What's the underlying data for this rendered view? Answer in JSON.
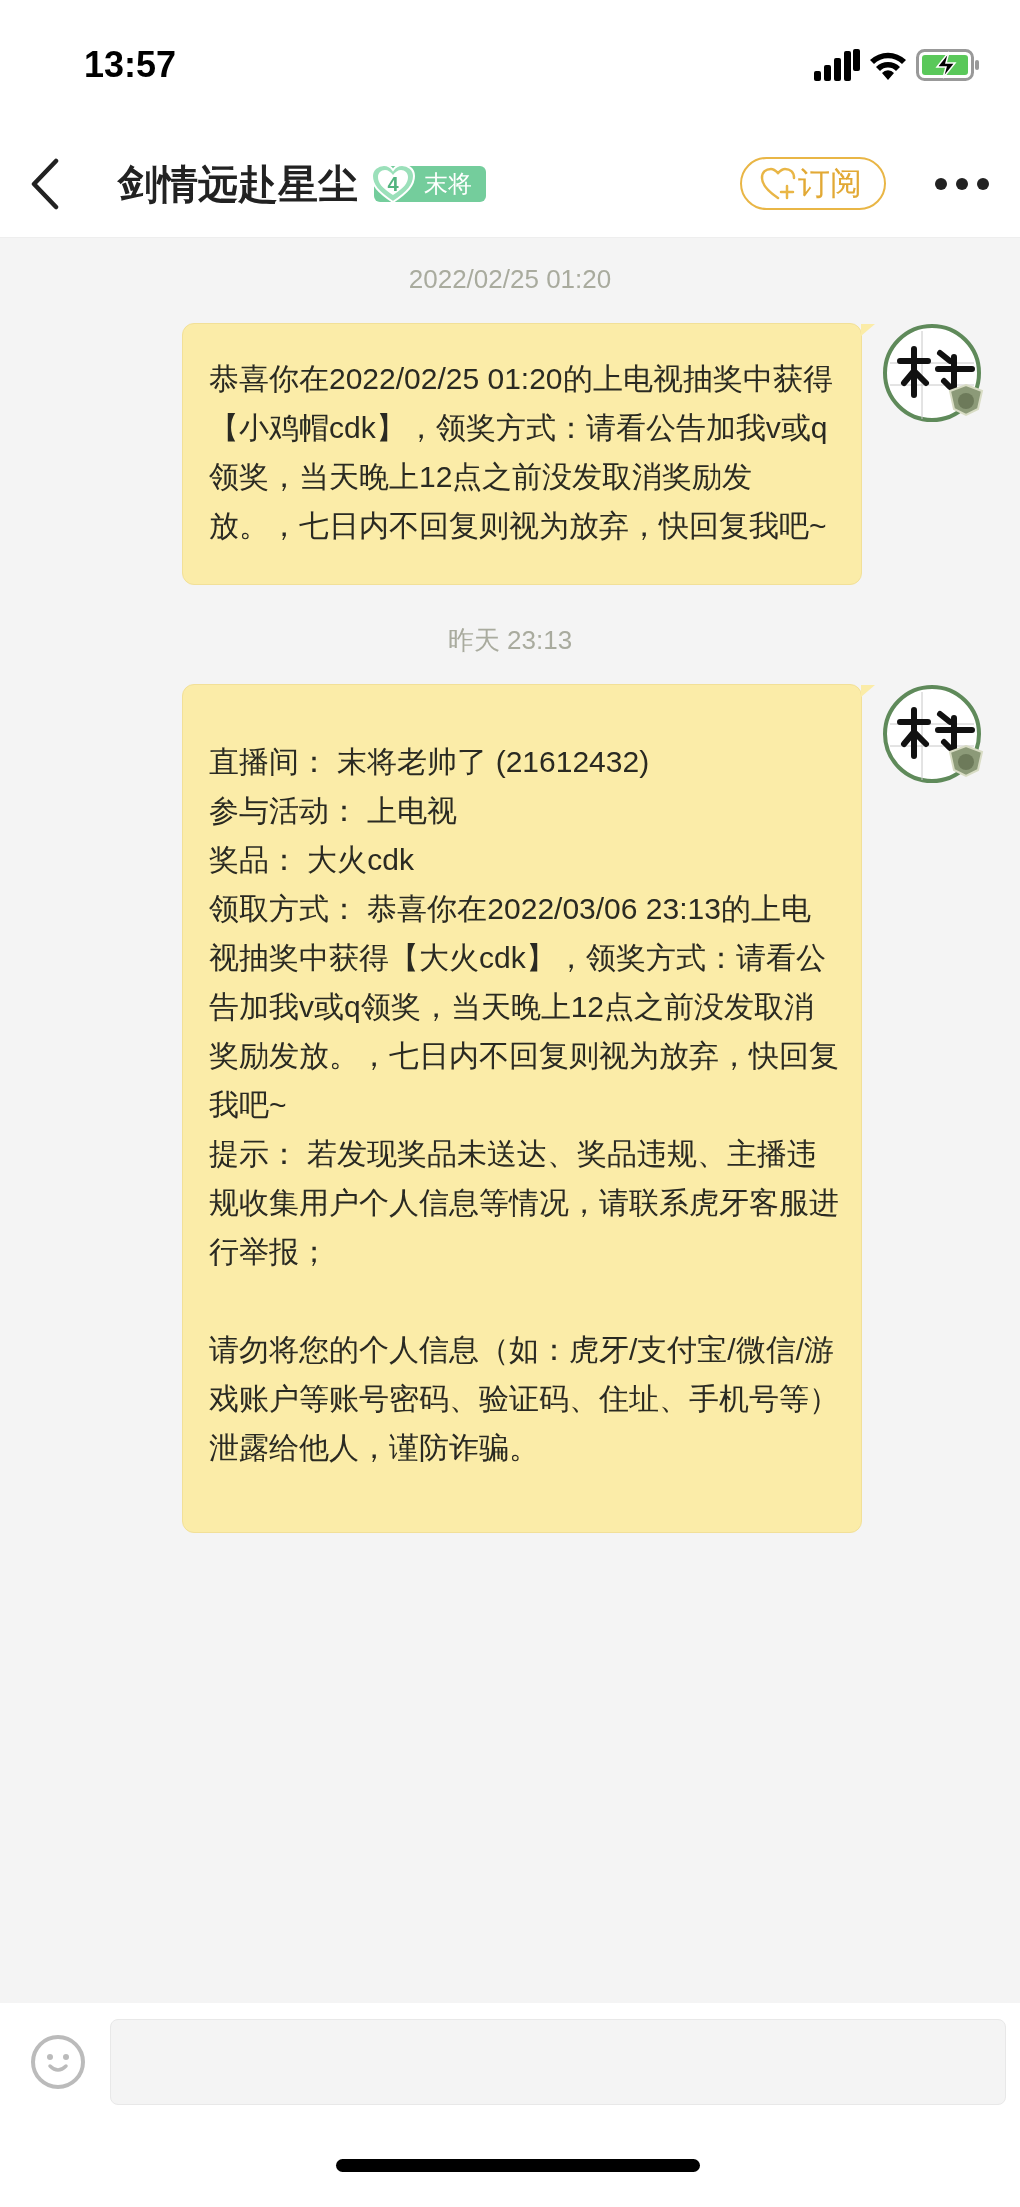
{
  "status_bar": {
    "time": "13:57"
  },
  "header": {
    "title": "剑情远赴星尘",
    "badge": {
      "rank": "4",
      "label": "末将"
    },
    "subscribe_button": "订阅"
  },
  "messages": [
    {
      "timestamp": "2022/02/25 01:20",
      "paragraphs": [
        [
          "恭喜你在2022/02/25 01:20的上电视抽奖中获得【小鸡帽cdk】，领奖方式：请看公告加我v或q领奖，当天晚上12点之前没发取消奖励发放。，七日内不回复则视为放弃，快回复我吧~"
        ]
      ]
    },
    {
      "timestamp": "昨天 23:13",
      "paragraphs": [
        [
          "直播间： 末将老帅了 (21612432)",
          "参与活动： 上电视",
          "奖品： 大火cdk",
          "领取方式： 恭喜你在2022/03/06 23:13的上电视抽奖中获得【大火cdk】，领奖方式：请看公告加我v或q领奖，当天晚上12点之前没发取消奖励发放。，七日内不回复则视为放弃，快回复我吧~",
          "提示： 若发现奖品未送达、奖品违规、主播违规收集用户个人信息等情况，请联系虎牙客服进行举报；"
        ],
        [
          "请勿将您的个人信息（如：虎牙/支付宝/微信/游戏账户等账号密码、验证码、住址、手机号等）泄露给他人，谨防诈骗。"
        ]
      ]
    }
  ]
}
